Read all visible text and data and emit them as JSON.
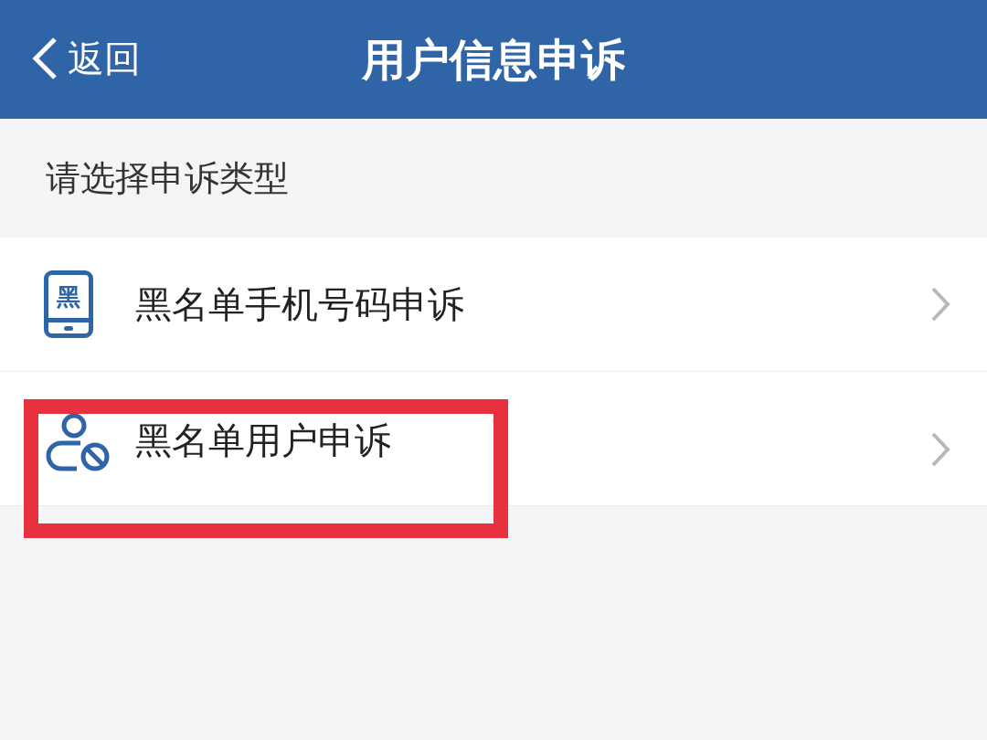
{
  "header": {
    "back_label": "返回",
    "title": "用户信息申诉"
  },
  "section_label": "请选择申诉类型",
  "items": [
    {
      "kind": "phone",
      "icon_text": "黑",
      "label": "黑名单手机号码申诉",
      "highlighted": false
    },
    {
      "kind": "user",
      "label": "黑名单用户申诉",
      "highlighted": true
    }
  ]
}
